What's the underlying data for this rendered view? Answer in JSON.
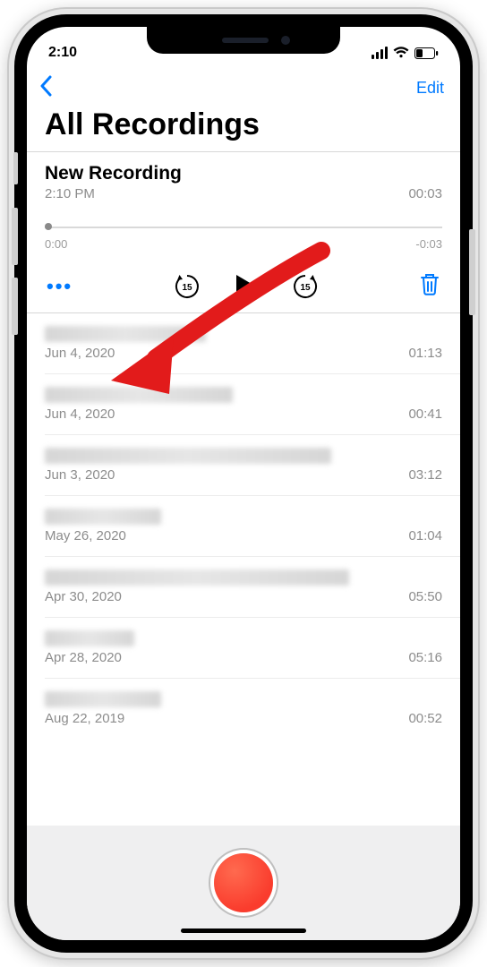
{
  "status": {
    "time": "2:10"
  },
  "navbar": {
    "edit": "Edit"
  },
  "page": {
    "title": "All Recordings"
  },
  "expanded": {
    "title": "New Recording",
    "time": "2:10 PM",
    "duration": "00:03",
    "scrub_start": "0:00",
    "scrub_end": "-0:03"
  },
  "rows": [
    {
      "date": "Jun 4, 2020",
      "dur": "01:13"
    },
    {
      "date": "Jun 4, 2020",
      "dur": "00:41"
    },
    {
      "date": "Jun 3, 2020",
      "dur": "03:12"
    },
    {
      "date": "May 26, 2020",
      "dur": "01:04"
    },
    {
      "date": "Apr 30, 2020",
      "dur": "05:50"
    },
    {
      "date": "Apr 28, 2020",
      "dur": "05:16"
    },
    {
      "date": "Aug 22, 2019",
      "dur": "00:52"
    }
  ],
  "colors": {
    "accent": "#007aff",
    "record": "#fa3c2d"
  }
}
